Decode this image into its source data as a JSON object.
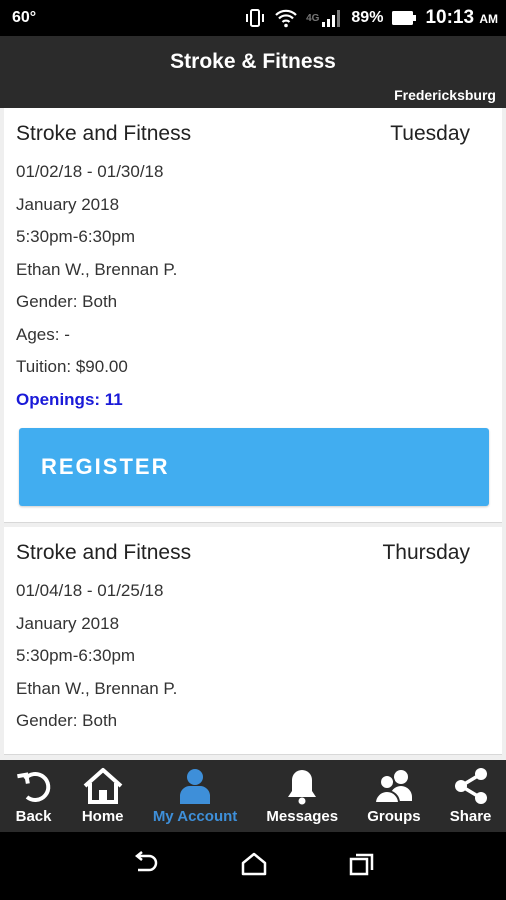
{
  "status": {
    "temp": "60°",
    "network": "4G",
    "battery": "89%",
    "time": "10:13",
    "ampm": "AM"
  },
  "header": {
    "title": "Stroke & Fitness",
    "location": "Fredericksburg"
  },
  "classes": [
    {
      "name": "Stroke and Fitness",
      "day": "Tuesday",
      "dates": "01/02/18 - 01/30/18",
      "month": "January 2018",
      "time": "5:30pm-6:30pm",
      "instructors": "Ethan W., Brennan P.",
      "gender": "Gender: Both",
      "ages": "Ages: -",
      "tuition": "Tuition: $90.00",
      "openings": "Openings: 11",
      "register_label": "REGISTER"
    },
    {
      "name": "Stroke and Fitness",
      "day": "Thursday",
      "dates": "01/04/18 - 01/25/18",
      "month": "January 2018",
      "time": "5:30pm-6:30pm",
      "instructors": "Ethan W., Brennan P.",
      "gender": "Gender: Both"
    }
  ],
  "nav": {
    "active": "My Account",
    "items": [
      {
        "label": "Back",
        "icon": "back-arrow-icon"
      },
      {
        "label": "Home",
        "icon": "home-icon"
      },
      {
        "label": "My Account",
        "icon": "user-icon"
      },
      {
        "label": "Messages",
        "icon": "bell-icon"
      },
      {
        "label": "Groups",
        "icon": "group-icon"
      },
      {
        "label": "Share",
        "icon": "share-icon"
      }
    ]
  },
  "colors": {
    "accent": "#41adf0",
    "active_nav": "#3e8fd9",
    "openings": "#1a1ad8",
    "bar": "#2b2b2b"
  }
}
